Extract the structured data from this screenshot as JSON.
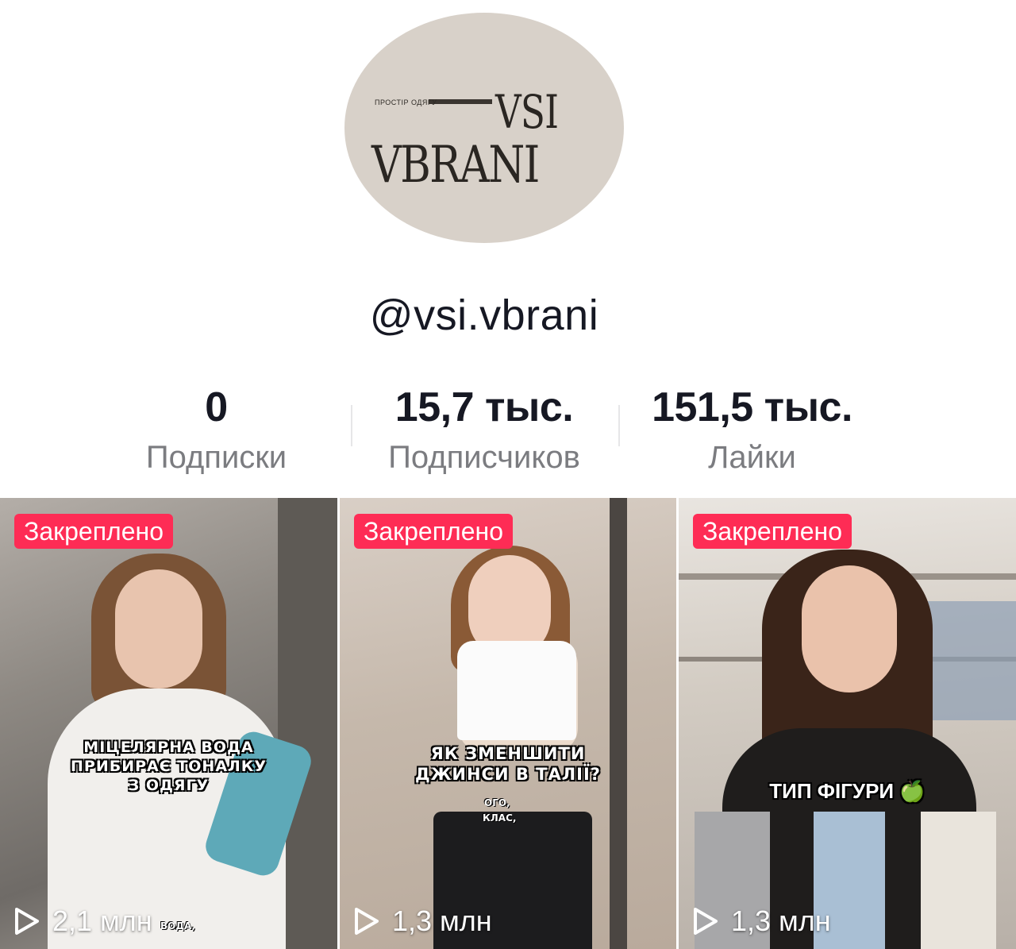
{
  "profile": {
    "avatar_logo": {
      "tagline": "ПРОСТІР ОДЯГУ",
      "line1": "VSI",
      "line2": "VBRANI"
    },
    "username": "@vsi.vbrani"
  },
  "stats": {
    "following": {
      "value": "0",
      "label": "Подписки"
    },
    "followers": {
      "value": "15,7 тыс.",
      "label": "Подписчиков"
    },
    "likes": {
      "value": "151,5 тыс.",
      "label": "Лайки"
    }
  },
  "videos": [
    {
      "badge": "Закреплено",
      "caption_lines": [
        "МІЦЕЛЯРНА ВОДА",
        "ПРИБИРАЄ ТОНАЛКУ",
        "З ОДЯГУ"
      ],
      "subtitle": "ВОДА,",
      "views": "2,1 млн",
      "icon": "play-icon"
    },
    {
      "badge": "Закреплено",
      "caption_lines": [
        "ЯК ЗМЕНШИТИ",
        "ДЖИНСИ В ТАЛІЇ?"
      ],
      "subtitle_lines": [
        "ОГО,",
        "КЛАС,"
      ],
      "views": "1,3 млн",
      "icon": "play-icon"
    },
    {
      "badge": "Закреплено",
      "caption": "ТИП ФІГУРИ 🍏",
      "views": "1,3 млн",
      "icon": "play-icon"
    }
  ],
  "colors": {
    "pinned_badge": "#fe2c55",
    "stat_label": "#7b7c80",
    "avatar_bg": "#d8d1c9"
  }
}
